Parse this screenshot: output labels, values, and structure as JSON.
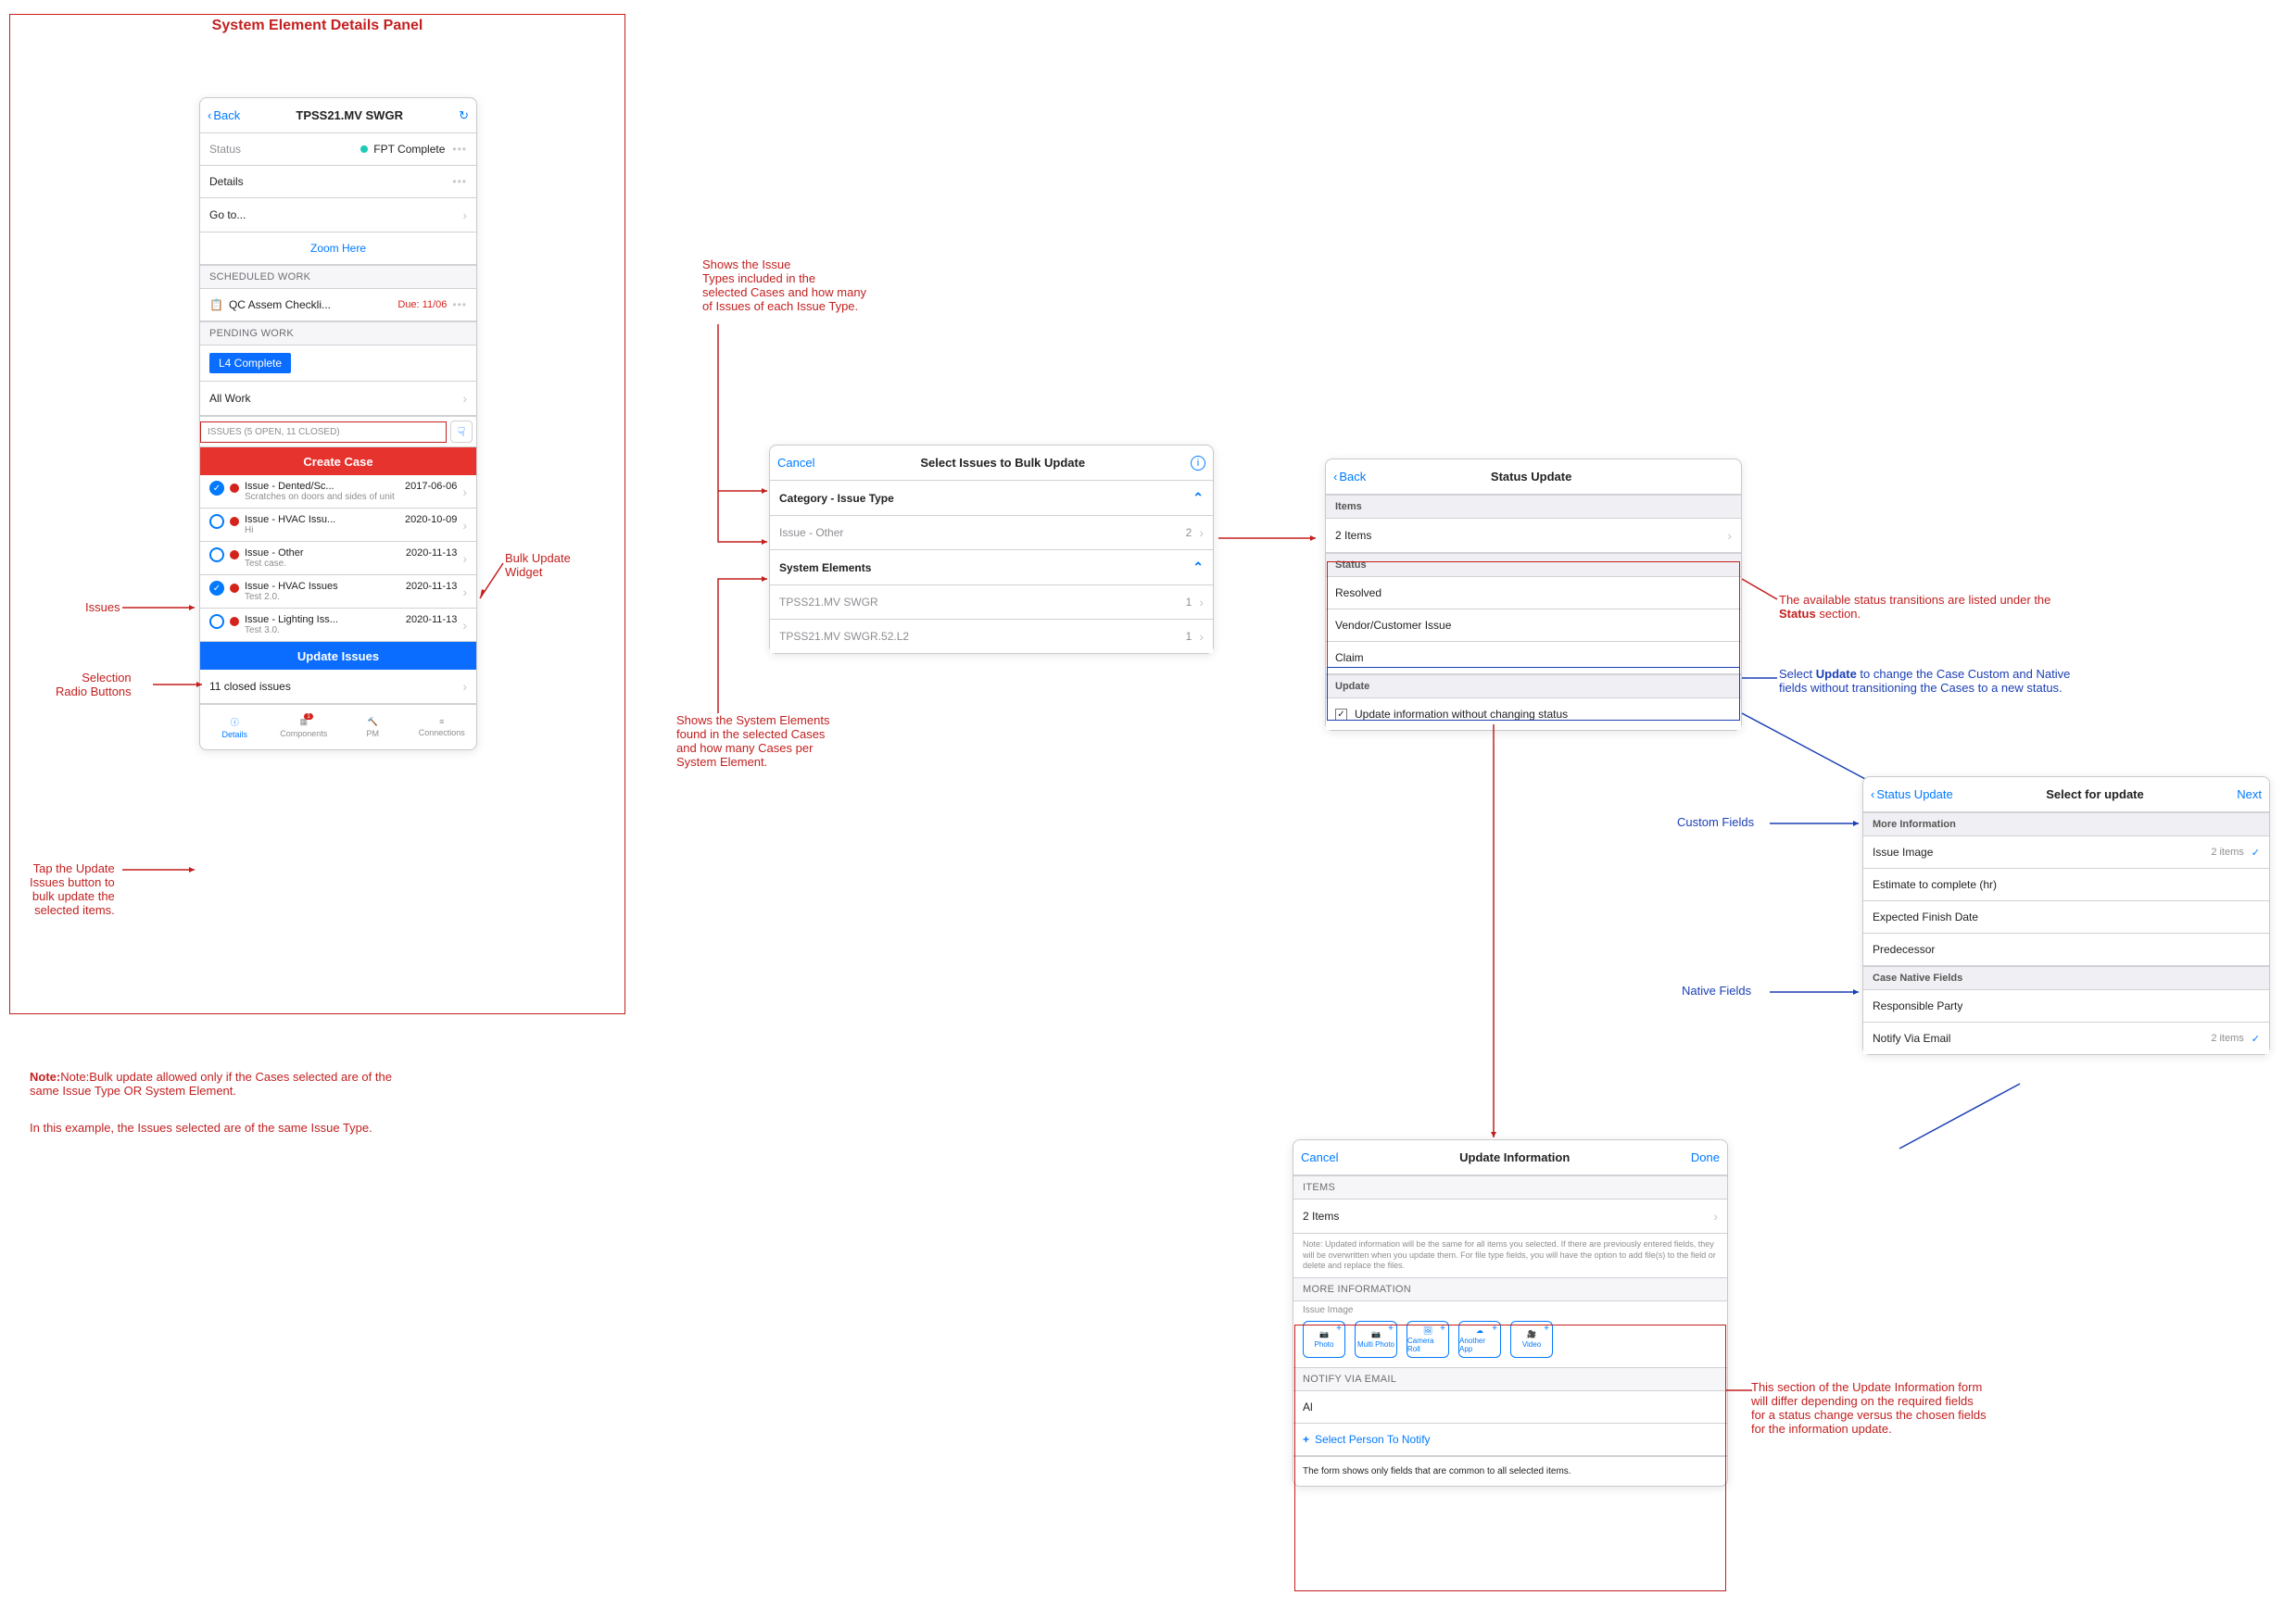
{
  "title": "System Element Details Panel",
  "annotations": {
    "issues": "Issues",
    "radio": "Selection\nRadio Buttons",
    "update_btn_note": "Tap the Update\nIssues button to\nbulk update the\nselected items.",
    "bulk_widget": "Bulk Update\nWidget",
    "note_line1": "Note:Bulk update allowed only if the Cases selected are of the\nsame Issue Type OR System Element.",
    "note_line2": "In this example, the Issues selected are of the same Issue Type.",
    "issue_types_note": "Shows the Issue\nTypes included in the\nselected Cases and how many\nof Issues of each Issue Type.",
    "sys_elem_note": "Shows the System Elements\n found in the selected Cases\nand how many Cases per\nSystem Element.",
    "status_note": "The available status transitions are listed under the\nStatus section.",
    "update_checkbox_note": "Select Update to change the Case Custom and Native\nfields without transitioning the Cases to a new status.",
    "custom_fields": "Custom Fields",
    "native_fields": "Native Fields",
    "update_info_note": "This section of the Update Information form\nwill differ depending on the required fields\nfor a status change versus the chosen fields\nfor the information update."
  },
  "details_panel": {
    "back": "Back",
    "title": "TPSS21.MV SWGR",
    "status_label": "Status",
    "status_value": "FPT Complete",
    "details": "Details",
    "goto": "Go to...",
    "zoom": "Zoom Here",
    "sched_hdr": "SCHEDULED WORK",
    "sched_item": "QC Assem Checkli...",
    "sched_due": "Due: 11/06",
    "pending_hdr": "PENDING WORK",
    "l4": "L4 Complete",
    "all_work": "All Work",
    "issues_hdr": "ISSUES (5 OPEN, 11 CLOSED)",
    "create_case": "Create Case",
    "issues": [
      {
        "checked": true,
        "title": "Issue - Dented/Sc...",
        "date": "2017-06-06",
        "sub": "Scratches on doors and sides of unit"
      },
      {
        "checked": false,
        "title": "Issue - HVAC Issu...",
        "date": "2020-10-09",
        "sub": "Hi"
      },
      {
        "checked": false,
        "title": "Issue - Other",
        "date": "2020-11-13",
        "sub": "Test case."
      },
      {
        "checked": true,
        "title": "Issue - HVAC Issues",
        "date": "2020-11-13",
        "sub": "Test 2.0."
      },
      {
        "checked": false,
        "title": "Issue - Lighting Iss...",
        "date": "2020-11-13",
        "sub": "Test 3.0."
      }
    ],
    "update_issues": "Update Issues",
    "closed": "11 closed issues",
    "tabs": [
      "Details",
      "Components",
      "PM",
      "Connections"
    ]
  },
  "bulk_panel": {
    "cancel": "Cancel",
    "title": "Select Issues to Bulk Update",
    "cat_hdr": "Category - Issue Type",
    "cat_row": {
      "label": "Issue - Other",
      "count": "2"
    },
    "sys_hdr": "System Elements",
    "sys_rows": [
      {
        "label": "TPSS21.MV SWGR",
        "count": "1"
      },
      {
        "label": "TPSS21.MV SWGR.52.L2",
        "count": "1"
      }
    ]
  },
  "status_panel": {
    "back": "Back",
    "title": "Status Update",
    "items_hdr": "Items",
    "items_val": "2 Items",
    "status_hdr": "Status",
    "statuses": [
      "Resolved",
      "Vendor/Customer Issue",
      "Claim"
    ],
    "update_hdr": "Update",
    "update_row": "Update information without changing status"
  },
  "select_panel": {
    "back": "Status Update",
    "title": "Select for update",
    "next": "Next",
    "more_hdr": "More Information",
    "rows_more": [
      {
        "label": "Issue Image",
        "right": "2 items",
        "check": true
      },
      {
        "label": "Estimate to complete (hr)"
      },
      {
        "label": "Expected Finish Date"
      },
      {
        "label": "Predecessor"
      }
    ],
    "native_hdr": "Case Native Fields",
    "rows_native": [
      {
        "label": "Responsible Party"
      },
      {
        "label": "Notify Via Email",
        "right": "2 items",
        "check": true
      }
    ]
  },
  "update_info_panel": {
    "cancel": "Cancel",
    "title": "Update Information",
    "done": "Done",
    "items_hdr": "ITEMS",
    "items_val": "2 Items",
    "note": "Note: Updated information will be the same for all items you selected. If there are previously entered fields, they will be overwritten when you update them. For file type fields, you will have the option to add file(s) to the field or delete and replace the files.",
    "more_hdr": "MORE INFORMATION",
    "issue_image": "Issue Image",
    "media": [
      "Photo",
      "Multi Photo",
      "Camera Roll",
      "Another App",
      "Video"
    ],
    "notify_hdr": "NOTIFY VIA EMAIL",
    "notify_val": "Al",
    "select_person": "Select Person To Notify",
    "footer": "The form shows only fields that are common to all selected items."
  }
}
